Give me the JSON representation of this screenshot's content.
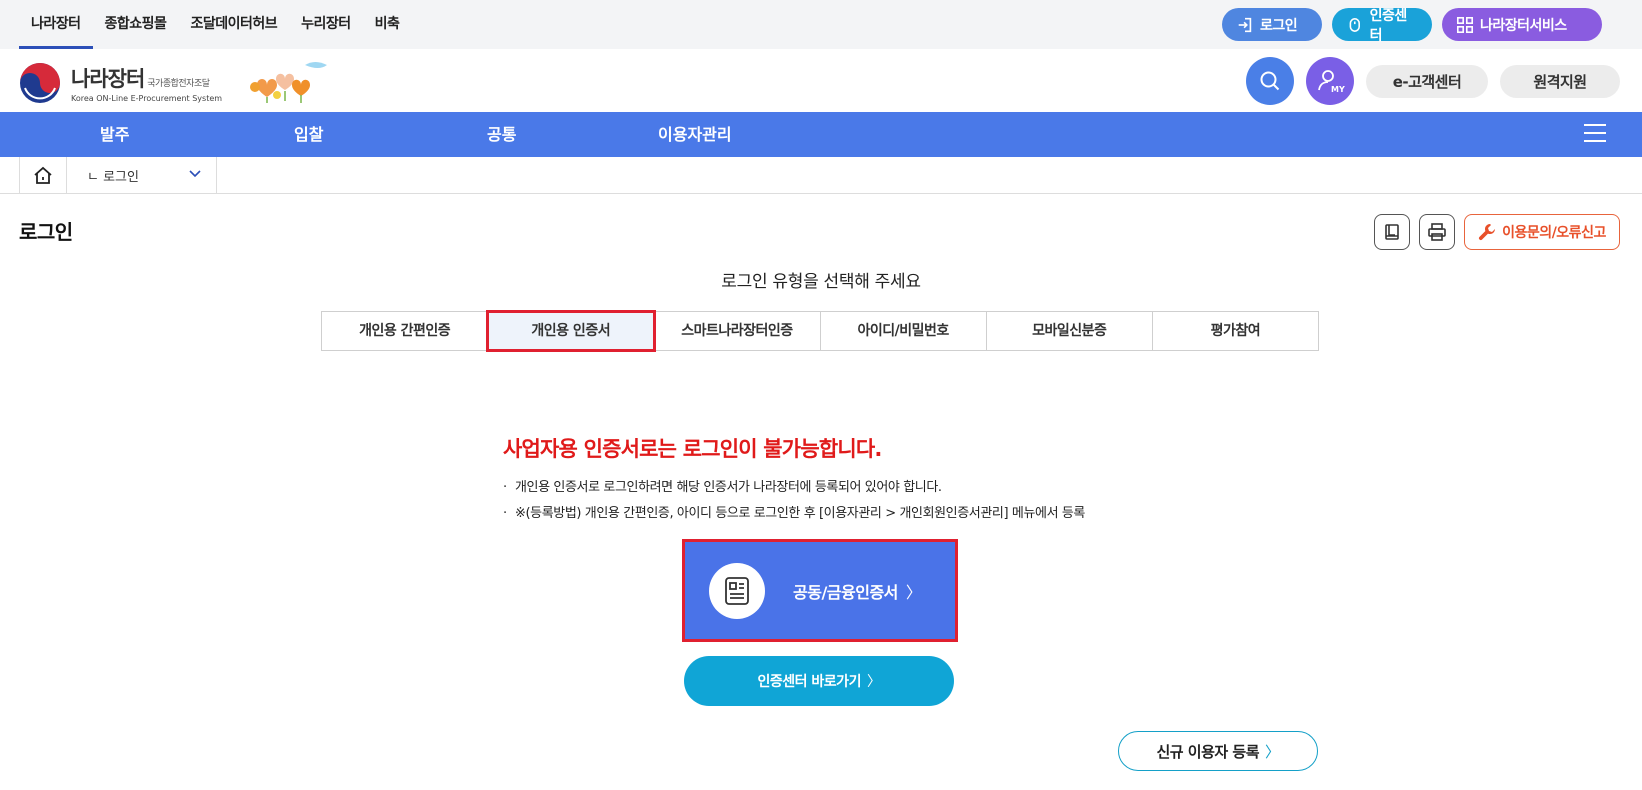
{
  "top_links": [
    "나라장터",
    "종합쇼핑몰",
    "조달데이터허브",
    "누리장터",
    "비축"
  ],
  "top_buttons": {
    "login": "로그인",
    "cert_center": "인증센터",
    "services": "나라장터서비스"
  },
  "logo": {
    "title": "나라장터",
    "title_small": "국가종합전자조달",
    "subtitle": "Korea ON-Line E-Procurement System"
  },
  "header_buttons": {
    "my": "MY",
    "customer_center": "e-고객센터",
    "remote": "원격지원"
  },
  "main_nav": [
    "발주",
    "입찰",
    "공통",
    "이용자관리"
  ],
  "breadcrumb": {
    "current": "ㄴ 로그인"
  },
  "page_title": "로그인",
  "tools": {
    "report": "이용문의/오류신고"
  },
  "login_type": {
    "title": "로그인 유형을 선택해 주세요",
    "tabs": [
      "개인용 간편인증",
      "개인용 인증서",
      "스마트나라장터인증",
      "아이디/비밀번호",
      "모바일신분증",
      "평가참여"
    ],
    "active_index": 1
  },
  "notice": {
    "warning": "사업자용 인증서로는 로그인이 불가능합니다.",
    "bullet": "·",
    "line1": "개인용 인증서로 로그인하려면 해당 인증서가 나라장터에 등록되어 있어야 합니다.",
    "line2": "※(등록방법) 개인용 간편인증, 아이디 등으로 로그인한 후 [이용자관리 > 개인회원인증서관리] 메뉴에서 등록"
  },
  "buttons": {
    "cert_login": "공동/금융인증서",
    "cert_center_go": "인증센터 바로가기",
    "new_user": "신규 이용자 등록",
    "arrow": "〉"
  },
  "colors": {
    "nav_blue": "#4a79e8",
    "warning_red": "#e01a1a",
    "highlight_red": "#e02030",
    "teal": "#10a5d6"
  }
}
